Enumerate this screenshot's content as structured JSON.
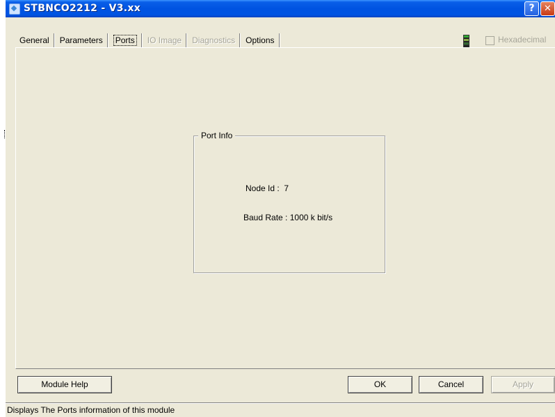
{
  "window": {
    "title": "STBNCO2212 - V3.xx",
    "help_button": "?",
    "close_button": "✕"
  },
  "tabs": [
    {
      "label": "General",
      "state": "normal"
    },
    {
      "label": "Parameters",
      "state": "normal"
    },
    {
      "label": "Ports",
      "state": "active"
    },
    {
      "label": "IO Image",
      "state": "disabled"
    },
    {
      "label": "Diagnostics",
      "state": "disabled"
    },
    {
      "label": "Options",
      "state": "normal"
    }
  ],
  "hexadecimal": {
    "label": "Hexadecimal",
    "checked": false,
    "enabled": false
  },
  "port_info": {
    "group_title": "Port Info",
    "node_id_label": "Node Id :",
    "node_id_value": "7",
    "baud_rate_label": "Baud Rate :",
    "baud_rate_value": "1000 k bit/s"
  },
  "buttons": {
    "module_help": "Module Help",
    "ok": "OK",
    "cancel": "Cancel",
    "apply": "Apply"
  },
  "status_bar": {
    "text": "Displays The Ports information of this module"
  },
  "colors": {
    "titlebar": "#0054e3",
    "dialog_bg": "#ece9d8",
    "disabled_text": "#a7a69a"
  }
}
